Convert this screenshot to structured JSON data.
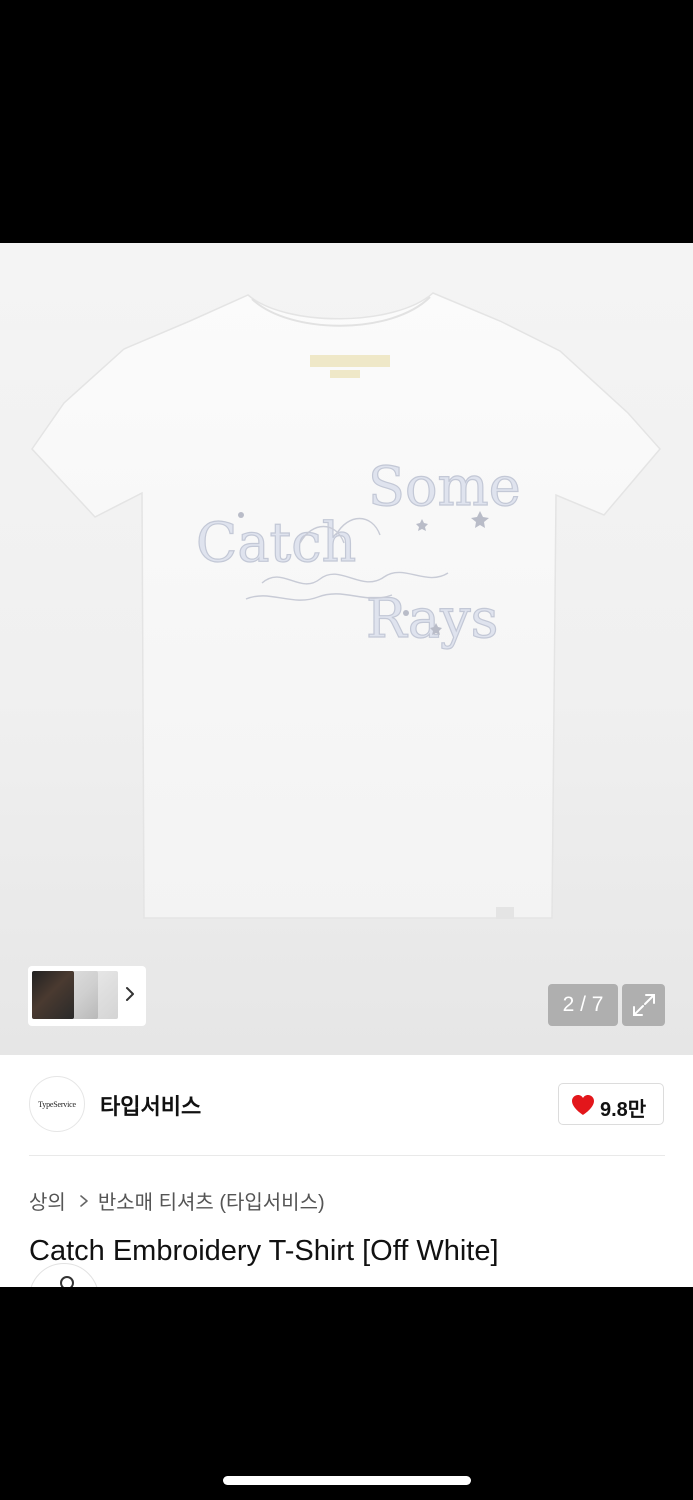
{
  "gallery": {
    "current_index": 2,
    "total": 7,
    "pager_text": "2 / 7",
    "print_words": [
      "Catch",
      "Some",
      "Rays"
    ]
  },
  "brand": {
    "logo_text": "TypeService",
    "name": "타입서비스"
  },
  "like": {
    "count_text": "9.8만",
    "heart_color": "#e3161b"
  },
  "breadcrumb": {
    "items": [
      "상의",
      "반소매 티셔츠 (타입서비스)"
    ]
  },
  "product": {
    "title": "Catch Embroidery T-Shirt [Off White]"
  },
  "icons": {
    "thumb_next": "chevron-right-icon",
    "expand": "expand-icon",
    "like": "heart-icon",
    "breadcrumb_sep": "chevron-right-icon"
  }
}
